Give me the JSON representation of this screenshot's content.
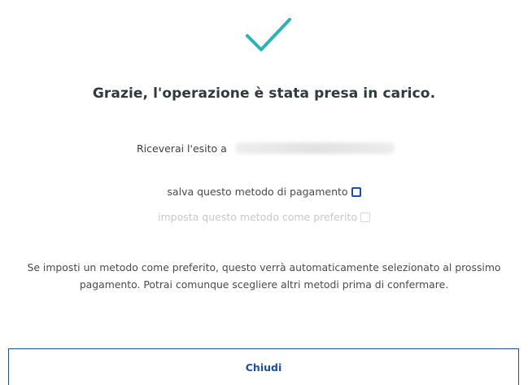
{
  "confirmation": {
    "icon": "checkmark-icon",
    "icon_color": "#2ab3b5",
    "title": "Grazie, l'operazione è stata presa in carico."
  },
  "recipient": {
    "label": "Riceverai l'esito a"
  },
  "options": {
    "save_method_label": "salva questo metodo di pagamento",
    "save_method_checked": false,
    "set_favorite_label": "imposta questo metodo come preferito",
    "set_favorite_checked": false,
    "set_favorite_disabled": true
  },
  "info_text": "Se imposti un metodo come preferito, questo verrà automaticamente selezionato al prossimo pagamento. Potrai comunque scegliere altri metodi prima di confermare.",
  "actions": {
    "close_label": "Chiudi"
  },
  "colors": {
    "accent": "#1c4fa8",
    "success": "#2ab3b5"
  }
}
